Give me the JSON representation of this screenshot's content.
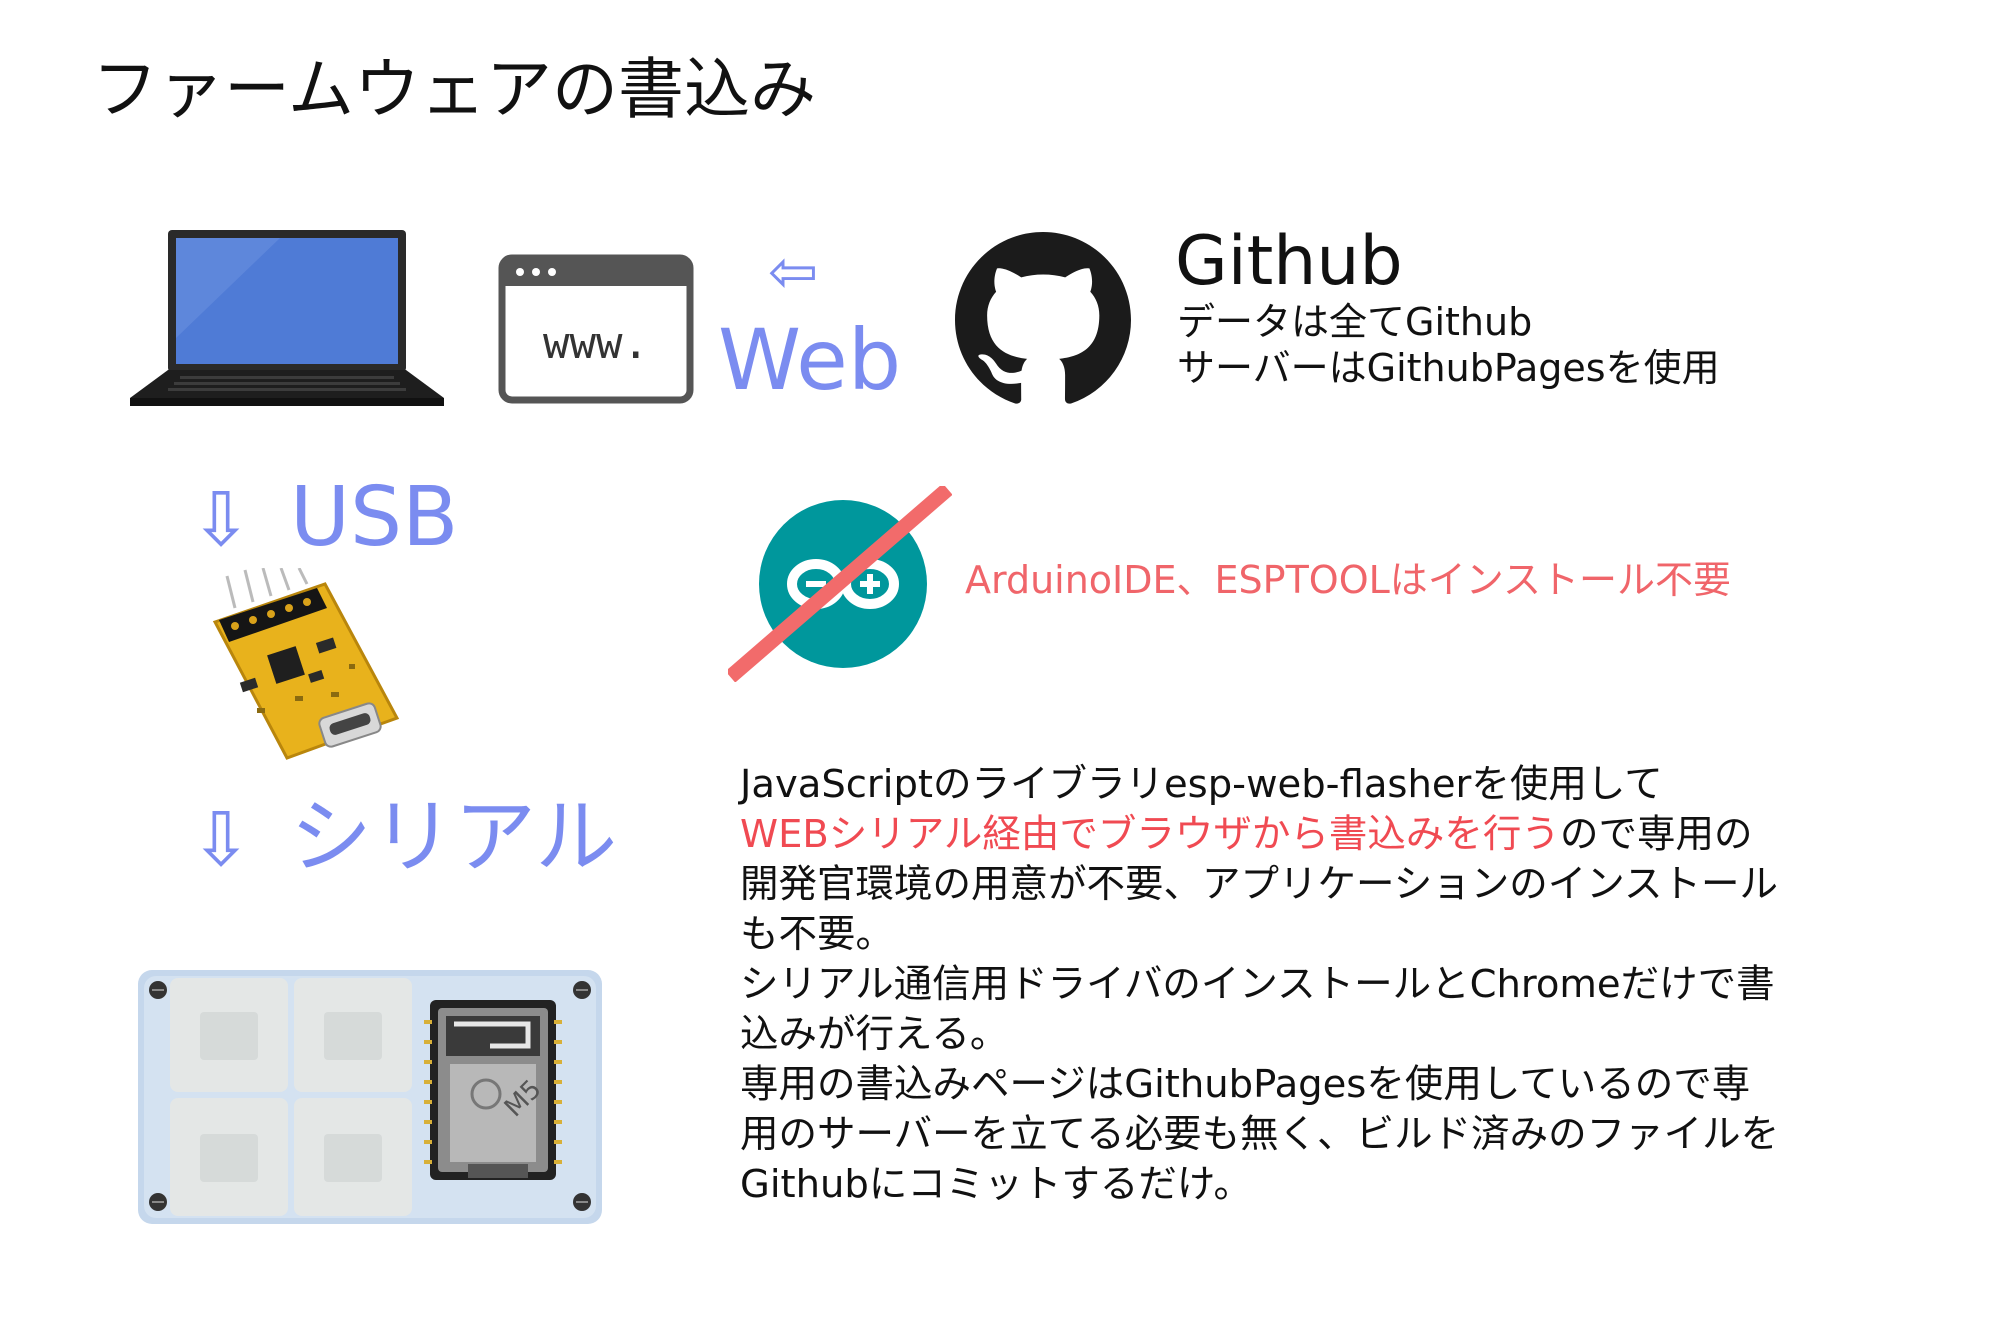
{
  "title": "ファームウェアの書込み",
  "flow": {
    "web_arrow": "⇦",
    "web_label": "Web",
    "usb_arrow": "⇩",
    "usb_label": "USB",
    "serial_arrow": "⇩",
    "serial_label": "シリアル"
  },
  "browser_icon": {
    "text": "www."
  },
  "github": {
    "title": "Github",
    "line1": "データは全てGithub",
    "line2": "サーバーはGithubPagesを使用"
  },
  "arduino_note": "ArduinoIDE、ESPTOOLはインストール不要",
  "device_label": "M5",
  "description": {
    "line1": "JavaScriptのライブラリesp-web-flasherを使用して",
    "line2_highlight": "WEBシリアル経由でブラウザから書込みを行う",
    "line2_rest": "ので専用の",
    "line3": "開発官環境の用意が不要、アプリケーションのインストール",
    "line4": "も不要。",
    "line5": "シリアル通信用ドライバのインストールとChromeだけで書",
    "line6": "込みが行える。",
    "line7": "専用の書込みページはGithubPagesを使用しているので専",
    "line8": "用のサーバーを立てる必要も無く、ビルド済みのファイルを",
    "line9": "Githubにコミットするだけ。"
  },
  "colors": {
    "accent_blue": "#7b8cf0",
    "highlight_red": "#f04a52",
    "note_red": "#f0656a",
    "arduino_teal": "#00979c",
    "pcb_yellow": "#e8b21c"
  },
  "icons": [
    "laptop-icon",
    "browser-window-icon",
    "github-octocat-icon",
    "arduino-logo-icon",
    "strike-slash-icon",
    "usb-serial-board-image",
    "m5-device-image"
  ]
}
